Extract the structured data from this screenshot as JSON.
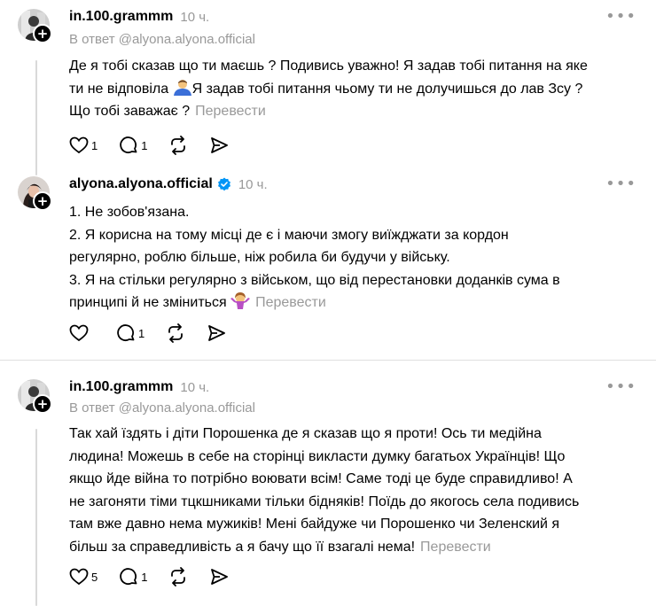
{
  "posts": [
    {
      "username": "in.100.grammm",
      "time": "10 ч.",
      "reply_to": "В ответ @alyona.alyona.official",
      "lines": [
        "Де я тобі сказав що ти маєшь ? Подивись уважно! Я задав тобі питання на яке",
        "ти не відповіла",
        "Я задав тобі питання чьому ти не долучишься до лав Зсу ?",
        "Що тобі заважає ?"
      ],
      "translate": "Перевести",
      "likes": "1",
      "comments": "1",
      "avatar_icon": "person-avatar-icon"
    },
    {
      "username": "alyona.alyona.official",
      "time": "10 ч.",
      "lines": [
        "1. Не зобов'язана.",
        "2. Я корисна на тому місці де є і маючи змогу виїжджати за кордон",
        "регулярно, роблю більше, ніж робила би будучи у війську.",
        "3. Я на стільки регулярно з військом, що від перестановки доданків сума в",
        "принципі й не зміниться"
      ],
      "translate": "Перевести",
      "likes": "",
      "comments": "1",
      "verified_color": "#0095f6"
    },
    {
      "username": "in.100.grammm",
      "time": "10 ч.",
      "reply_to": "В ответ @alyona.alyona.official",
      "lines": [
        "Так хай їздять і діти Порошенка де я сказав що я проти! Ось ти медійна",
        "людина! Можешь в себе на сторінці викласти думку багатьох Українців! Що",
        "якщо йде війна то потрібно воювати всім! Саме тоді це буде справидливо! А",
        "не загоняти тіми тцкшниками тільки бідняків! Поїдь до якогось села подивись",
        "там вже давно нема мужиків! Мені байдуже чи Порошенко чи Зеленский я",
        "більш за справедливість а я бачу що її взагалі нема!"
      ],
      "translate": "Перевести",
      "likes": "5",
      "comments": "1"
    }
  ],
  "icons": {
    "like": "heart-icon",
    "comment": "comment-bubble-icon",
    "repost": "repost-icon",
    "share": "send-icon",
    "more": "more-dots-icon",
    "follow": "plus-icon"
  }
}
